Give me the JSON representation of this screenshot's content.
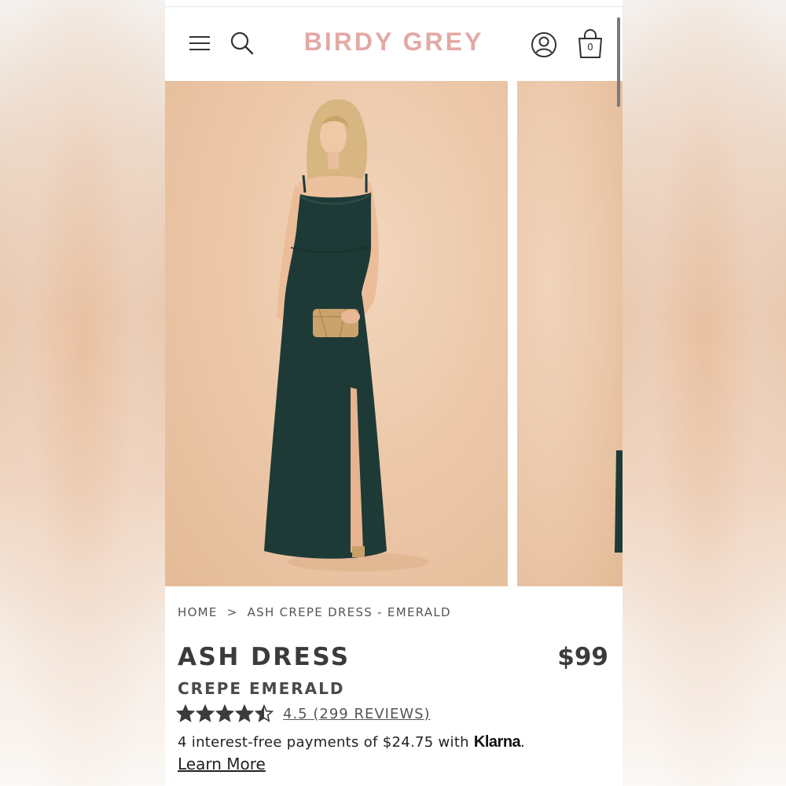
{
  "header": {
    "logo": "BIRDY GREY",
    "cart_count": "0",
    "menu_icon": "hamburger-menu-icon",
    "search_icon": "search-icon",
    "account_icon": "user-account-icon",
    "bag_icon": "shopping-bag-icon"
  },
  "gallery": {
    "main_image": "Model wearing emerald green ash crepe dress holding gold clutch",
    "next_image": "Next product image"
  },
  "breadcrumb": {
    "home": "HOME",
    "separator": ">",
    "current": "ASH CREPE DRESS - EMERALD"
  },
  "product": {
    "title": "ASH DRESS",
    "variant": "CREPE EMERALD",
    "price": "$99",
    "rating_value": 4.5,
    "rating_max": 5,
    "reviews_label": "4.5 (299 REVIEWS)"
  },
  "payments": {
    "text": "4 interest-free payments of $24.75 with ",
    "provider": "Klarna",
    "suffix": ".",
    "learn_more": "Learn More"
  },
  "colors": {
    "logo": "#e3a9a5",
    "text": "#3b3b3b",
    "dress": "#1e3a36",
    "backdrop": "#ecc8a9"
  }
}
